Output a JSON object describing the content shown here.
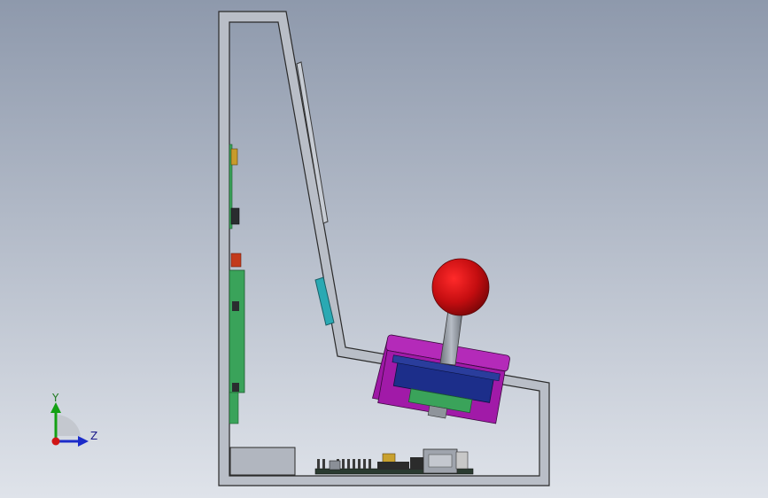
{
  "viewport": {
    "background_top": "#8d98ab",
    "background_bottom": "#dfe3ea",
    "colors": {
      "frame_outline": "#2b2b2b",
      "frame_fill": "#b7bcc6",
      "ball": "#c40d10",
      "shaft": "#8d939c",
      "joystick_base": "#a11aa8",
      "joystick_mount": "#1c2e8a",
      "board_green": "#3aa35a",
      "teal_part": "#2aa9b3"
    }
  },
  "triad": {
    "y_label": "Y",
    "z_label": "Z",
    "y_color": "#13a013",
    "z_color": "#1b2bc9",
    "origin_color": "#d01515"
  }
}
